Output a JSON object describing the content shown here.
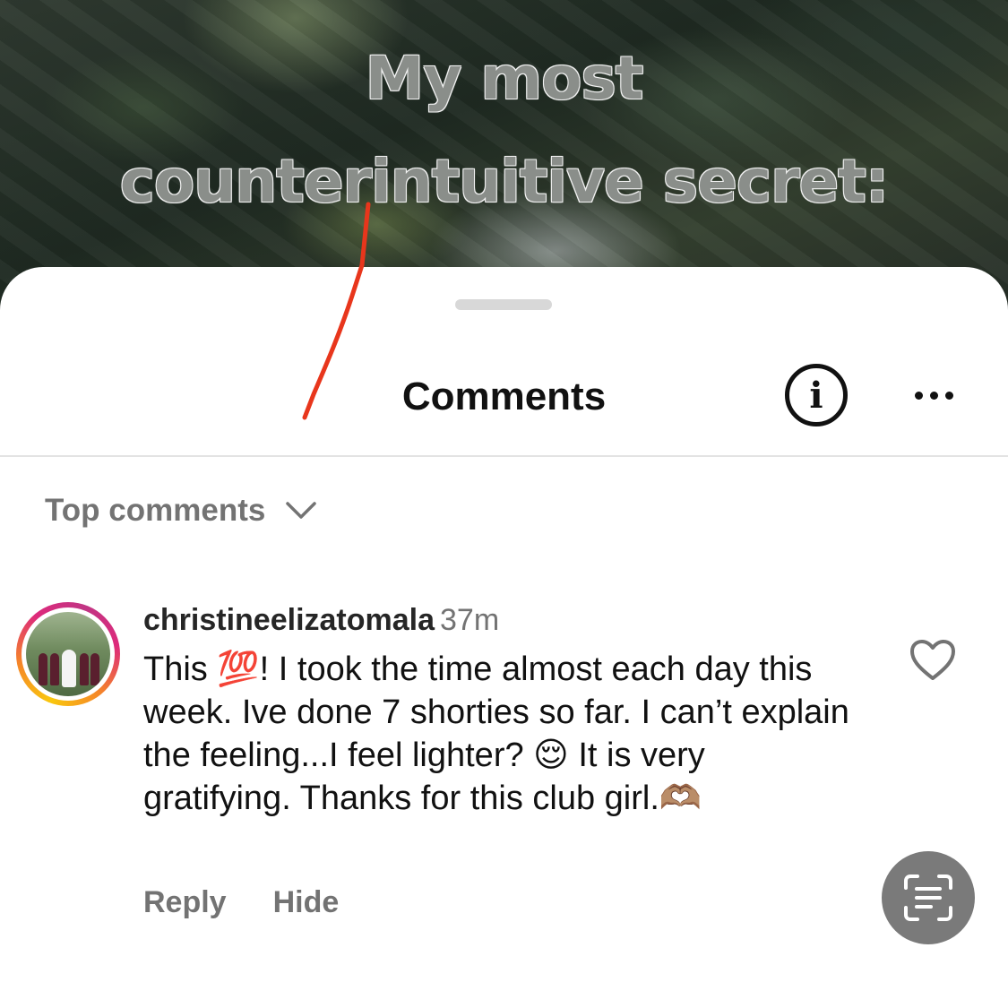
{
  "video": {
    "title_line1": "My most",
    "title_line2": "counterintuitive secret:"
  },
  "sheet": {
    "title": "Comments",
    "info_icon_glyph": "i",
    "sort_label": "Top comments"
  },
  "comment": {
    "username": "christineelizatomala",
    "time": "37m",
    "text": "This 💯! I took the time almost each day this week. Ive done 7 shorties so far. I can’t explain the feeling...I feel lighter? 😌 It is very gratifying. Thanks for this club girl.🫶🏽",
    "reply_label": "Reply",
    "hide_label": "Hide"
  },
  "icons": {
    "info": "info-icon",
    "more": "more-options-icon",
    "sort": "chevron-down-icon",
    "like": "heart-icon",
    "scan": "text-scan-icon"
  },
  "colors": {
    "annotation_stroke": "#e8361c",
    "secondary_text": "#737373",
    "avatar_ring_start": "#f9c70d",
    "avatar_ring_end": "#dd2a7b"
  }
}
